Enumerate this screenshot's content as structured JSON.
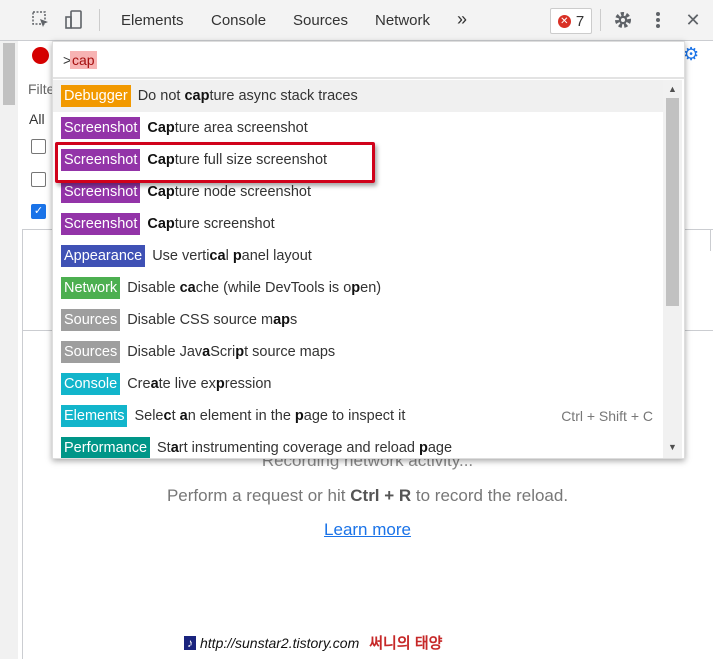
{
  "toolbar": {
    "tabs": [
      "Elements",
      "Console",
      "Sources",
      "Network"
    ],
    "more_tabs_label": "»",
    "error_count": "7",
    "close_label": "✕"
  },
  "network": {
    "filter_placeholder": "Filte",
    "all_label": "All",
    "recording_text": "Recording network activity...",
    "perform_prefix": "Perform a request or hit ",
    "perform_shortcut": "Ctrl + R",
    "perform_suffix": " to record the reload.",
    "learn_more": "Learn more"
  },
  "palette": {
    "prompt": ">",
    "query": "cap",
    "items": [
      {
        "category": "Debugger",
        "color": "#f29900",
        "parts": [
          [
            "Do not ",
            0
          ],
          [
            "cap",
            1
          ],
          [
            "ture async stack traces",
            0
          ]
        ],
        "shortcut": ""
      },
      {
        "category": "Screenshot",
        "color": "#9334a8",
        "parts": [
          [
            "Cap",
            1
          ],
          [
            "ture area screenshot",
            0
          ]
        ],
        "shortcut": ""
      },
      {
        "category": "Screenshot",
        "color": "#9334a8",
        "parts": [
          [
            "Cap",
            1
          ],
          [
            "ture full size screenshot",
            0
          ]
        ],
        "shortcut": ""
      },
      {
        "category": "Screenshot",
        "color": "#9334a8",
        "parts": [
          [
            "Cap",
            1
          ],
          [
            "ture node screenshot",
            0
          ]
        ],
        "shortcut": ""
      },
      {
        "category": "Screenshot",
        "color": "#9334a8",
        "parts": [
          [
            "Cap",
            1
          ],
          [
            "ture screenshot",
            0
          ]
        ],
        "shortcut": ""
      },
      {
        "category": "Appearance",
        "color": "#3f51b5",
        "parts": [
          [
            "Use verti",
            0
          ],
          [
            "ca",
            1
          ],
          [
            "l ",
            0
          ],
          [
            "p",
            1
          ],
          [
            "anel layout",
            0
          ]
        ],
        "shortcut": ""
      },
      {
        "category": "Network",
        "color": "#4caf50",
        "parts": [
          [
            "Disable ",
            0
          ],
          [
            "ca",
            1
          ],
          [
            "che (while DevTools is o",
            0
          ],
          [
            "p",
            1
          ],
          [
            "en)",
            0
          ]
        ],
        "shortcut": ""
      },
      {
        "category": "Sources",
        "color": "#9e9e9e",
        "parts": [
          [
            "Disable CSS source m",
            0
          ],
          [
            "ap",
            1
          ],
          [
            "s",
            0
          ]
        ],
        "shortcut": ""
      },
      {
        "category": "Sources",
        "color": "#9e9e9e",
        "parts": [
          [
            "Disable Jav",
            0
          ],
          [
            "a",
            1
          ],
          [
            "Scri",
            0
          ],
          [
            "p",
            1
          ],
          [
            "t source maps",
            0
          ]
        ],
        "shortcut": ""
      },
      {
        "category": "Console",
        "color": "#12b5cb",
        "parts": [
          [
            "Cre",
            0
          ],
          [
            "a",
            1
          ],
          [
            "te live ex",
            0
          ],
          [
            "p",
            1
          ],
          [
            "ression",
            0
          ]
        ],
        "shortcut": ""
      },
      {
        "category": "Elements",
        "color": "#12b5cb",
        "parts": [
          [
            "Sele",
            0
          ],
          [
            "c",
            1
          ],
          [
            "t ",
            0
          ],
          [
            "a",
            1
          ],
          [
            "n element in the ",
            0
          ],
          [
            "p",
            1
          ],
          [
            "age to inspect it",
            0
          ]
        ],
        "shortcut": "Ctrl + Shift + C"
      },
      {
        "category": "Performance",
        "color": "#009688",
        "parts": [
          [
            "St",
            0
          ],
          [
            "a",
            1
          ],
          [
            "rt instrumenting coverage and reload ",
            0
          ],
          [
            "p",
            1
          ],
          [
            "age",
            0
          ]
        ],
        "shortcut": ""
      }
    ]
  },
  "watermark": {
    "icon": "♪",
    "url": "http://sunstar2.tistory.com",
    "korean": "써니의 태양"
  }
}
